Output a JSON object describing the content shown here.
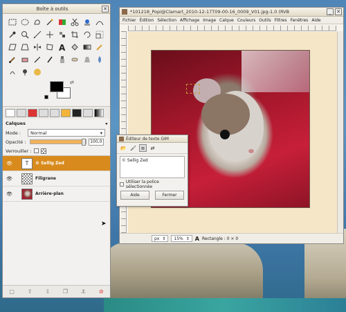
{
  "toolbox": {
    "title": "Boîte à outils",
    "close": "✕",
    "colors": {
      "foreground": "#000000",
      "background": "#ffffff"
    }
  },
  "layers": {
    "heading": "Calques",
    "mode_label": "Mode :",
    "mode_value": "Normal",
    "opacity_label": "Opacité :",
    "opacity_value": "100,0",
    "opacity_fraction": 1.0,
    "lock_label": "Verrouiller :",
    "items": [
      {
        "name": "© Sellig Zed",
        "selected": true,
        "type": "text"
      },
      {
        "name": "Filigrane",
        "selected": false,
        "type": "grid"
      },
      {
        "name": "Arrière-plan",
        "selected": false,
        "type": "photo"
      }
    ]
  },
  "image_window": {
    "title": "*101218_Popi@Clamart_2010-12-17T09-00-16_0009_V01.jpg-1.0 (RVB",
    "menu": [
      "Fichier",
      "Édition",
      "Sélection",
      "Affichage",
      "Image",
      "Calque",
      "Couleurs",
      "Outils",
      "Filtres",
      "Fenêtres",
      "Aide"
    ],
    "status": {
      "unit": "px",
      "zoom": "15%",
      "info": "Rectangle : 0 × 0"
    }
  },
  "text_editor": {
    "title": "Éditeur de texte GIM",
    "text": "© Sellig Zed",
    "use_font_label": "Utiliser la police sélectionnée",
    "help_button": "Aide",
    "close_button": "Fermer"
  },
  "accent": "#d88b1c"
}
